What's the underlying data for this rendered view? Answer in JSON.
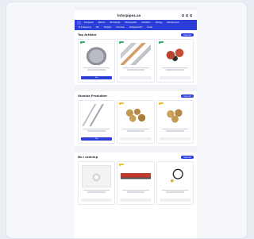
{
  "colors": {
    "primary": "#2b3ed8",
    "background": "#e9eef5",
    "badge_green": "#3cb371",
    "badge_yellow": "#f2c230"
  },
  "header": {
    "logo": "Interpipes.se"
  },
  "nav": {
    "items": [
      "Kampanjer",
      "Badrum",
      "Rörmaterial",
      "Värmesystem",
      "Ventilation",
      "Verktyg",
      "Värmepumpar",
      "El & Belysning",
      "Kök",
      "Trädgård",
      "VVS-delar",
      "Fastighetsvård",
      "Övrigt"
    ]
  },
  "sections": [
    {
      "title": "Top Artiklar",
      "more": "Visa mer",
      "products": [
        {
          "image": "valve",
          "badge": "green",
          "price": "",
          "button": "Köp",
          "button_style": "blue"
        },
        {
          "image": "pipes",
          "badge": "green",
          "price": "",
          "button": "",
          "button_style": "grey"
        },
        {
          "image": "boxes",
          "badge": "green",
          "price": "",
          "button": "",
          "button_style": "grey"
        }
      ]
    },
    {
      "title": "Utvalda Produkter",
      "more": "Visa mer",
      "products": [
        {
          "image": "rods",
          "badge": "",
          "price": "",
          "button": "Köp",
          "button_style": "blue"
        },
        {
          "image": "brass",
          "badge": "yellow",
          "price": "",
          "button": "",
          "button_style": "grey"
        },
        {
          "image": "brass2",
          "badge": "yellow",
          "price": "",
          "button": "",
          "button_style": "grey"
        }
      ]
    },
    {
      "title": "Nu i ordning",
      "more": "Visa mer",
      "products": [
        {
          "image": "ring",
          "badge": "",
          "price": "",
          "button": "",
          "button_style": "grey"
        },
        {
          "image": "roll",
          "badge": "yellow",
          "price": "",
          "button": "",
          "button_style": "grey"
        },
        {
          "image": "cable",
          "badge": "",
          "price": "",
          "button": "",
          "button_style": "grey"
        }
      ]
    }
  ]
}
